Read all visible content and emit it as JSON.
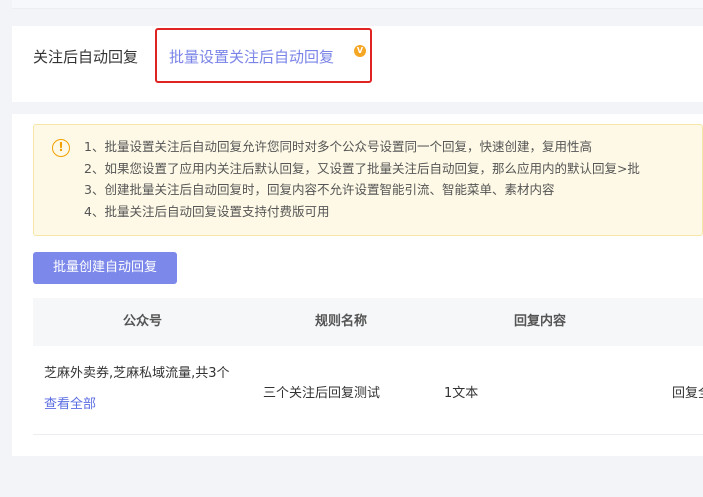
{
  "tabs": {
    "plain_label": "关注后自动回复",
    "active_label": "批量设置关注后自动回复",
    "badge": "V"
  },
  "notice": {
    "icon": "!",
    "lines": [
      "1、批量设置关注后自动回复允许您同时对多个公众号设置同一个回复，快速创建，复用性高",
      "2、如果您设置了应用内关注后默认回复，又设置了批量关注后自动回复，那么应用内的默认回复>批",
      "3、创建批量关注后自动回复时，回复内容不允许设置智能引流、智能菜单、素材内容",
      "4、批量关注后自动回复设置支持付费版可用"
    ]
  },
  "actions": {
    "create_label": "批量创建自动回复"
  },
  "table": {
    "columns": [
      "公众号",
      "规则名称",
      "回复内容"
    ],
    "rows": [
      {
        "accounts": "芝麻外卖券,芝麻私域流量,共3个",
        "view_all": "查看全部",
        "rule_name": "三个关注后回复测试",
        "content": "1文本",
        "extra": "回复全"
      }
    ]
  }
}
